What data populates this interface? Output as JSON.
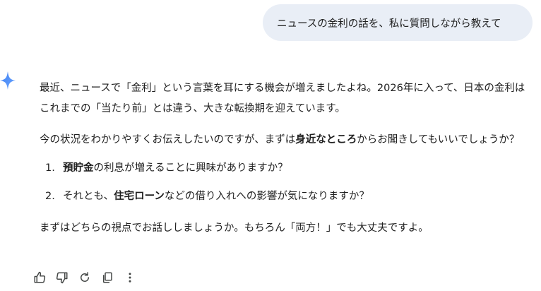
{
  "user_message": "ニュースの金利の話を、私に質問しながら教えて",
  "response": {
    "p1": "最近、ニュースで「金利」という言葉を耳にする機会が増えましたよね。2026年に入って、日本の金利はこれまでの「当たり前」とは違う、大きな転換期を迎えています。",
    "p2_before": "今の状況をわかりやすくお伝えしたいのですが、まずは",
    "p2_bold": "身近なところ",
    "p2_after": "からお聞きしてもいいでしょうか？",
    "list": [
      {
        "num": "1.",
        "before": "",
        "bold": "預貯金",
        "after": "の利息が増えることに興味がありますか？"
      },
      {
        "num": "2.",
        "before": "それとも、",
        "bold": "住宅ローン",
        "after": "などの借り入れへの影響が気になりますか？"
      }
    ],
    "p3": "まずはどちらの視点でお話ししましょうか。もちろん「両方！」でも大丈夫ですよ。"
  },
  "icons": {
    "assistant": "gemini-spark-icon",
    "actions": [
      "thumbs-up-icon",
      "thumbs-down-icon",
      "regenerate-icon",
      "copy-icon",
      "more-vert-icon"
    ]
  },
  "colors": {
    "bubble": "#e9eef6",
    "text": "#1f1f1f",
    "spark": "#4f8df5",
    "icon": "#444746"
  }
}
